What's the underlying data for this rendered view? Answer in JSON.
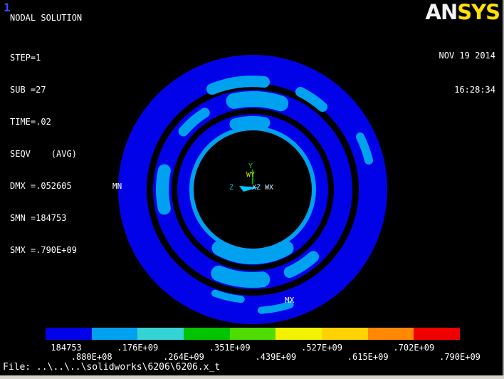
{
  "header": {
    "plot_number": "1",
    "title": "NODAL SOLUTION",
    "logo_an": "AN",
    "logo_sys": "SYS",
    "date": "NOV 19 2014",
    "time": "16:28:34"
  },
  "info": {
    "lines": [
      "STEP=1",
      "SUB =27",
      "TIME=.02",
      "SEQV    (AVG)",
      "DMX =.052605",
      "SMN =184753",
      "SMX =.790E+09"
    ]
  },
  "model": {
    "mn_label": "MN",
    "mx_label": "MX",
    "triad": {
      "y": "Y",
      "wy": "WY",
      "z": "Z",
      "xz": "XZ",
      "wx": "WX"
    },
    "low_color": "#0202e8",
    "patch_color": "#00a2f0"
  },
  "legend": {
    "segments": [
      "#0202e8",
      "#00a2f0",
      "#35d3d3",
      "#00c400",
      "#51dc00",
      "#f2f200",
      "#ffd300",
      "#ff8800",
      "#f00000"
    ],
    "row1": [
      "184753",
      ".176E+09",
      ".351E+09",
      ".527E+09",
      ".702E+09"
    ],
    "row2": [
      ".880E+08",
      ".264E+09",
      ".439E+09",
      ".615E+09",
      ".790E+09"
    ]
  },
  "footer": {
    "file_line": "File: ..\\..\\..\\solidworks\\6206\\6206.x_t"
  }
}
